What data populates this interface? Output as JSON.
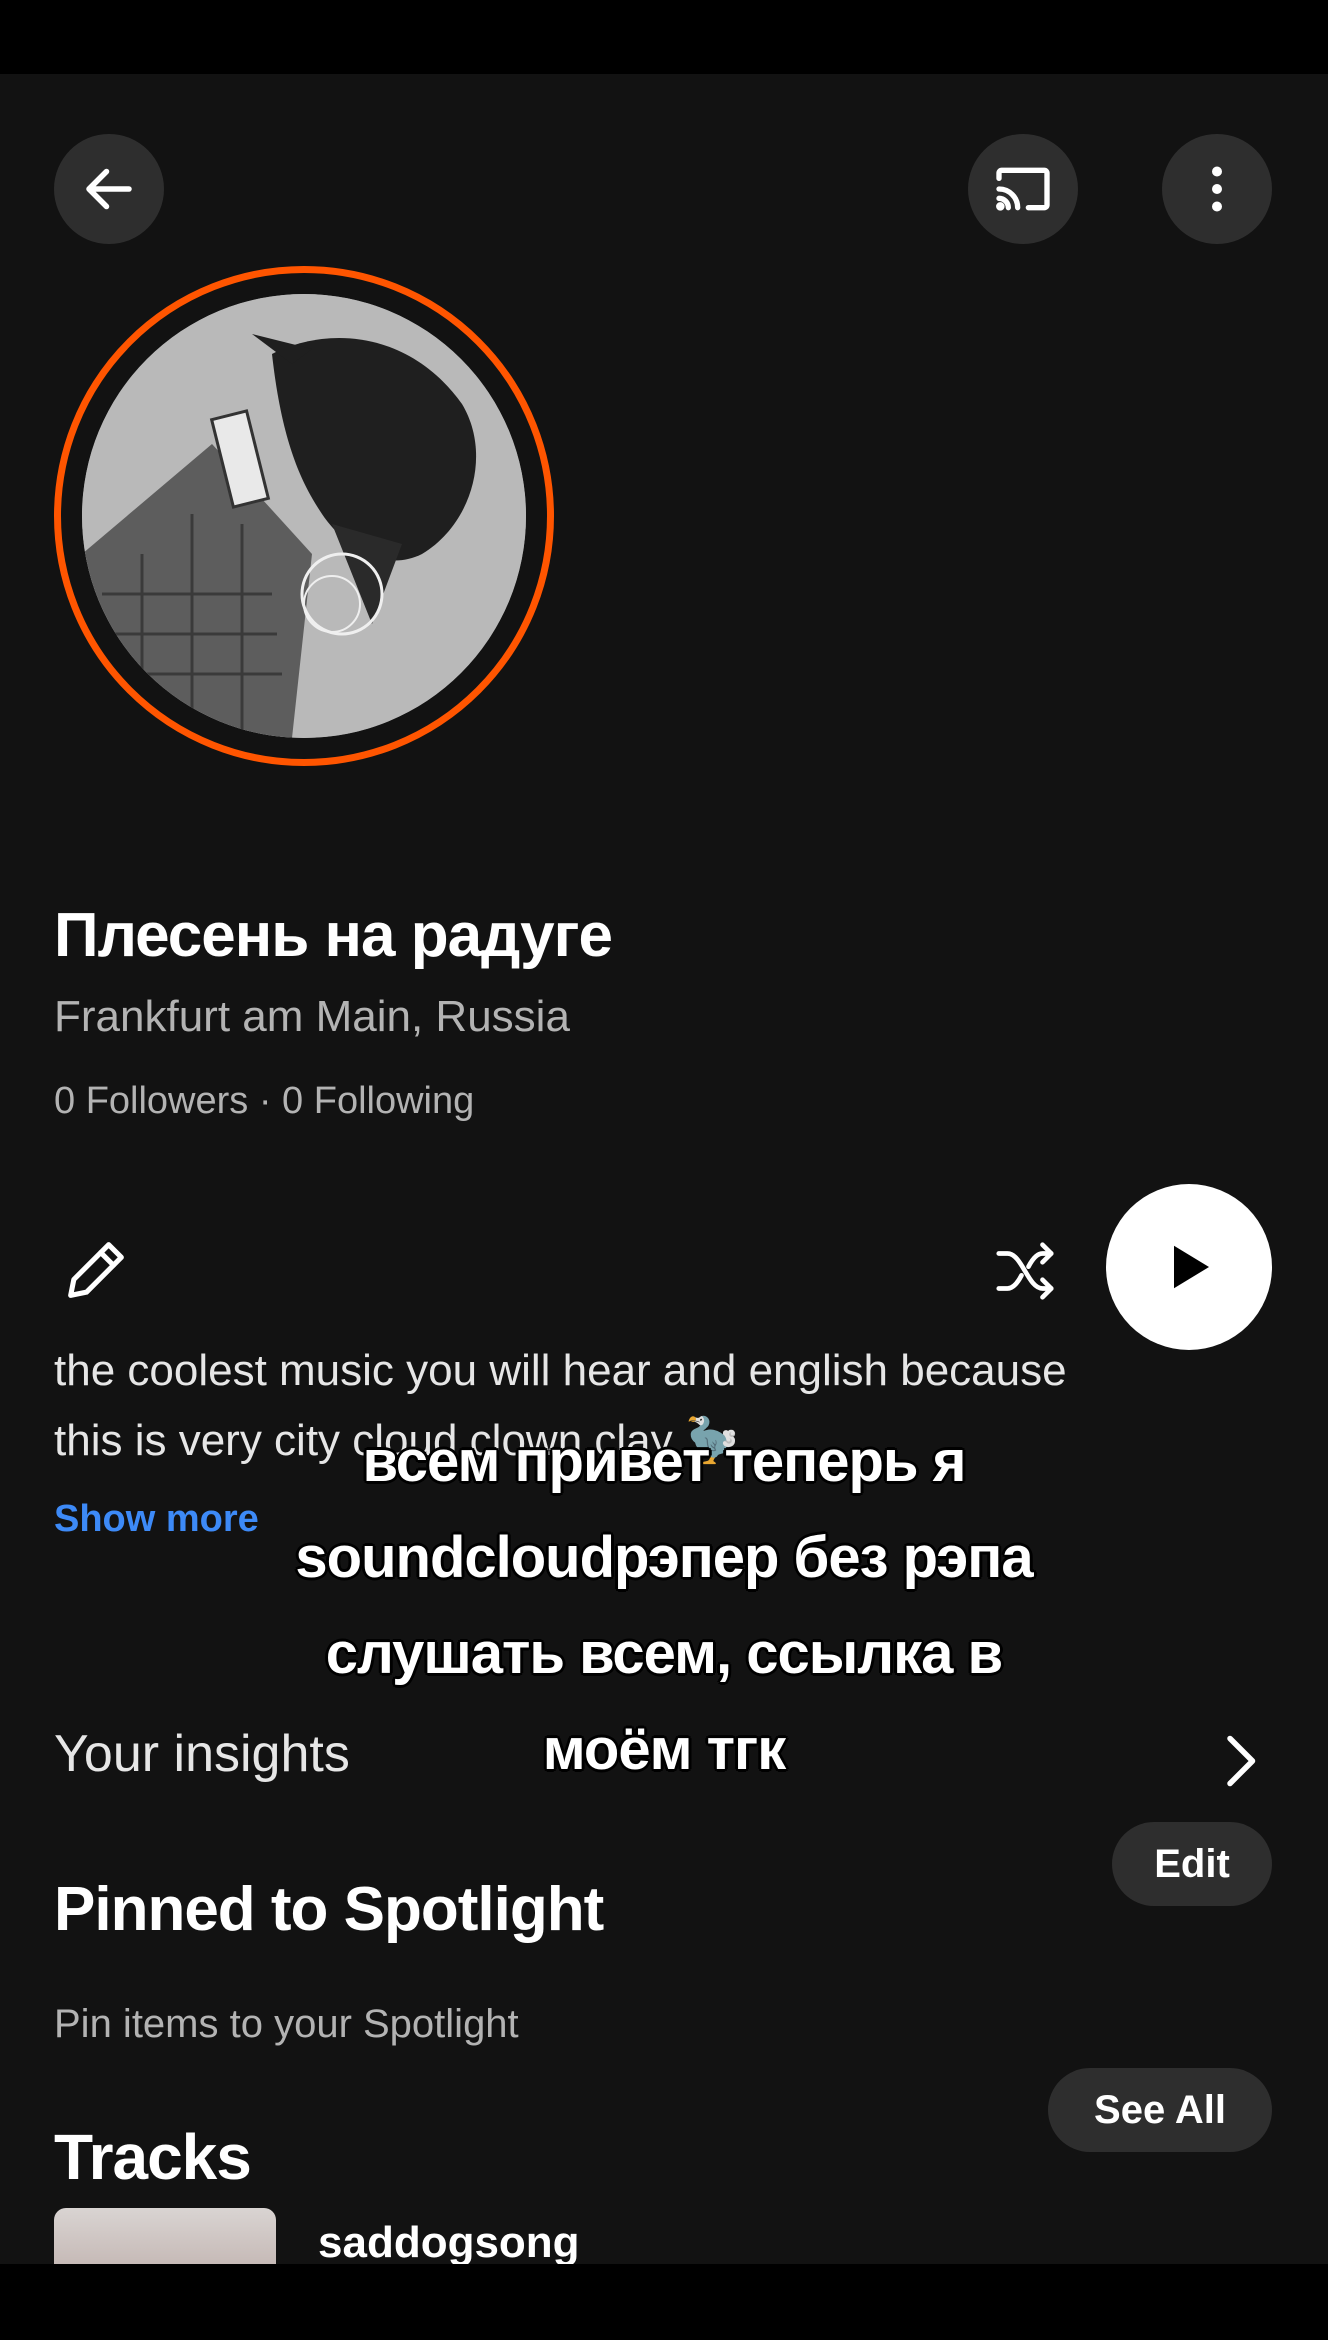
{
  "profile": {
    "name": "Плесень на радуге",
    "location": "Frankfurt am Main, Russia",
    "stats": "0 Followers · 0 Following",
    "bio_line1": "the coolest music you will hear and english because",
    "bio_line2": "this is very city cloud clown clay 🦤",
    "show_more": "Show more"
  },
  "insights": {
    "label": "Your insights"
  },
  "spotlight": {
    "title": "Pinned to Spotlight",
    "edit_label": "Edit",
    "subtitle": "Pin items to your Spotlight"
  },
  "tracks": {
    "title": "Tracks",
    "see_all": "See All",
    "items": [
      {
        "title": "saddogsong"
      }
    ]
  },
  "caption": {
    "lines": [
      "всем привет теперь я",
      "soundcloudрэпер без рэпа",
      "слушать всем, ссылка в",
      "моём тгк"
    ]
  },
  "icons": {
    "back": "arrow-left-icon",
    "cast": "cast-icon",
    "more": "more-vertical-icon",
    "edit": "pencil-icon",
    "shuffle": "shuffle-icon",
    "play": "play-icon",
    "chevron": "chevron-right-icon"
  },
  "colors": {
    "background": "#121212",
    "accent_ring": "#ff5500",
    "link": "#3d8af7"
  }
}
